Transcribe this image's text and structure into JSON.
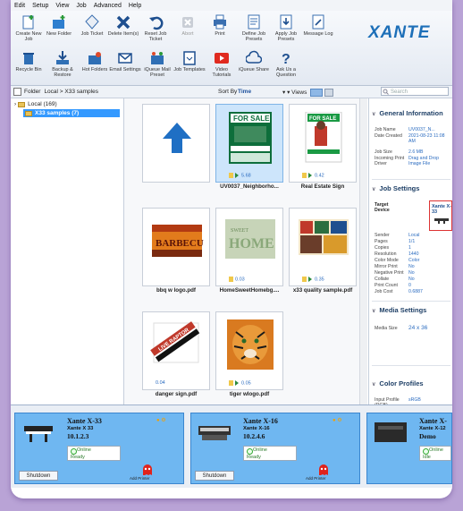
{
  "menu": [
    "Edit",
    "Setup",
    "View",
    "Job",
    "Advanced",
    "Help"
  ],
  "brand": "XANTE",
  "ribbon_top": [
    {
      "label": "Create New Job",
      "icon": "new-job-icon"
    },
    {
      "label": "New Folder",
      "icon": "new-folder-icon"
    },
    {
      "label": "Job Ticket",
      "icon": "job-ticket-icon"
    },
    {
      "label": "Delete Item(s)",
      "icon": "delete-icon"
    },
    {
      "label": "Reset Job Ticket",
      "icon": "reset-icon"
    },
    {
      "label": "Abort",
      "icon": "abort-icon",
      "disabled": true
    },
    {
      "label": "Print",
      "icon": "print-icon"
    },
    {
      "label": "Define Job Presets",
      "icon": "define-presets-icon"
    },
    {
      "label": "Apply Job Presets",
      "icon": "apply-presets-icon"
    },
    {
      "label": "Message Log",
      "icon": "message-log-icon"
    }
  ],
  "ribbon_bottom": [
    {
      "label": "Recycle Bin",
      "icon": "recycle-bin-icon"
    },
    {
      "label": "Backup & Restore",
      "icon": "backup-icon"
    },
    {
      "label": "Hot Folders",
      "icon": "hot-folders-icon"
    },
    {
      "label": "Email Settings",
      "icon": "email-icon"
    },
    {
      "label": "iQueue Mail Preset",
      "icon": "mail-preset-icon"
    },
    {
      "label": "Job Templates",
      "icon": "templates-icon"
    },
    {
      "label": "Video Tutorials",
      "icon": "video-icon"
    },
    {
      "label": "iQueue Share",
      "icon": "share-icon"
    },
    {
      "label": "Ask Us a Question",
      "icon": "question-icon"
    }
  ],
  "address": {
    "folder_label": "Folder",
    "path": "Local > X33 samples",
    "sort_label": "Sort By",
    "sort_value": "Time",
    "views_label": "Views",
    "search_placeholder": "Search"
  },
  "tree": [
    {
      "label": "Local (169)",
      "selected": false
    },
    {
      "label": "X33 samples (7)",
      "selected": true
    }
  ],
  "thumbnails": [
    {
      "name": "",
      "meta": "",
      "type": "upload"
    },
    {
      "name": "UV0037_Neighborho...",
      "meta": "5.68",
      "type": "forsale",
      "selected": true
    },
    {
      "name": "Real Estate Sign",
      "meta": "0.42",
      "type": "realestate"
    },
    {
      "name": "bbq w logo.pdf",
      "meta": "",
      "type": "bbq"
    },
    {
      "name": "HomeSweetHomebg....",
      "meta": "0.03",
      "type": "home"
    },
    {
      "name": "x33 quality sample.pdf",
      "meta": "0.35",
      "type": "quality"
    },
    {
      "name": "danger sign.pdf",
      "meta": "0.04",
      "type": "danger"
    },
    {
      "name": "tiger wlogo.pdf",
      "meta": "0.05",
      "type": "tiger"
    }
  ],
  "general": {
    "title": "General Information",
    "rows": [
      {
        "k": "Job Name",
        "v": "UV0037_N..."
      },
      {
        "k": "Date Created",
        "v": "2021-08-23 11:08 AM"
      },
      {
        "k": "Job Size",
        "v": "2.6 MB"
      },
      {
        "k": "Incoming Print Driver",
        "v": "Drag and Drop Image File"
      }
    ]
  },
  "job_settings": {
    "title": "Job Settings",
    "target_label": "Target Device",
    "target_value": "Xante X-33",
    "rows": [
      {
        "k": "Sender",
        "v": "Local"
      },
      {
        "k": "Pages",
        "v": "1/1"
      },
      {
        "k": "Copies",
        "v": "1"
      },
      {
        "k": "Resolution",
        "v": "1440"
      },
      {
        "k": "Color Mode",
        "v": "Color"
      },
      {
        "k": "Mirror Print",
        "v": "No"
      },
      {
        "k": "Negative Print",
        "v": "No"
      },
      {
        "k": "Collate",
        "v": "No"
      },
      {
        "k": "Print Count",
        "v": "0"
      },
      {
        "k": "Job Cost",
        "v": "0.6887"
      }
    ]
  },
  "media": {
    "title": "Media Settings",
    "k": "Media Size",
    "v": "24 x 36"
  },
  "color": {
    "title": "Color Profiles",
    "k": "Input Profile (RGB)",
    "v": "sRGB"
  },
  "printers": [
    {
      "name": "Xante X-33",
      "model": "Xante X 33",
      "version": "10.1.2.3",
      "status1": "Online",
      "status2": "Ready",
      "shutdown": "Shutdown",
      "ghost": "Add Printer"
    },
    {
      "name": "Xante X-16",
      "model": "Xante X-16",
      "version": "10.2.4.6",
      "status1": "Online",
      "status2": "Ready",
      "shutdown": "Shutdown",
      "ghost": "Add Printer"
    },
    {
      "name": "Xante X-",
      "model": "Xante X-12",
      "version": "Demo",
      "status1": "Online",
      "status2": "Idle",
      "shutdown": "",
      "ghost": ""
    }
  ],
  "colors": {
    "accent": "#1d6fb8",
    "printer_card": "#6fb7f1",
    "selection": "#3399ff",
    "highlight_border": "#dd3333"
  }
}
